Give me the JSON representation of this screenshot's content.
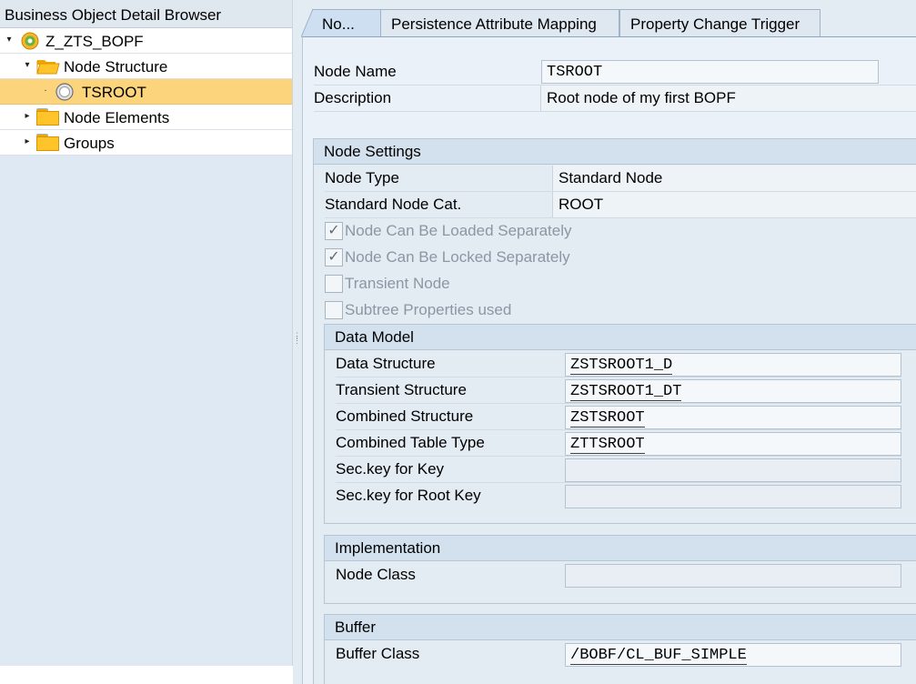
{
  "left_panel": {
    "title": "Business Object Detail Browser",
    "tree": [
      {
        "label": "Z_ZTS_BOPF",
        "icon": "business-object-icon",
        "expander": "▾"
      },
      {
        "label": "Node Structure",
        "icon": "open-folder-icon",
        "expander": "▾"
      },
      {
        "label": "TSROOT",
        "icon": "node-icon",
        "expander": "·",
        "selected": true
      },
      {
        "label": "Node Elements",
        "icon": "folder-icon",
        "expander": "▸"
      },
      {
        "label": "Groups",
        "icon": "folder-icon",
        "expander": "▸"
      }
    ]
  },
  "tabs": [
    {
      "label": "No...",
      "active": true
    },
    {
      "label": "Persistence Attribute Mapping",
      "active": false
    },
    {
      "label": "Property Change Trigger",
      "active": false
    }
  ],
  "node": {
    "name_label": "Node Name",
    "name_value": "TSROOT",
    "description_label": "Description",
    "description_value": "Root node of my first BOPF"
  },
  "node_settings": {
    "title": "Node Settings",
    "node_type_label": "Node Type",
    "node_type_value": "Standard Node",
    "category_label": "Standard Node Cat.",
    "category_value": "ROOT",
    "checkboxes": [
      {
        "label": "Node Can Be Loaded Separately",
        "checked": true,
        "mark": "✓"
      },
      {
        "label": "Node Can Be Locked Separately",
        "checked": true,
        "mark": "✓"
      },
      {
        "label": "Transient Node",
        "checked": false,
        "mark": ""
      },
      {
        "label": "Subtree Properties used",
        "checked": false,
        "mark": ""
      }
    ]
  },
  "data_model": {
    "title": "Data Model",
    "fields": [
      {
        "label": "Data Structure",
        "value": "ZSTSROOT1_D"
      },
      {
        "label": "Transient Structure",
        "value": "ZSTSROOT1_DT"
      },
      {
        "label": "Combined Structure",
        "value": "ZSTSROOT"
      },
      {
        "label": "Combined Table Type",
        "value": "ZTTSROOT"
      },
      {
        "label": "Sec.key for Key",
        "value": ""
      },
      {
        "label": "Sec.key for Root Key",
        "value": ""
      }
    ]
  },
  "implementation": {
    "title": "Implementation",
    "node_class_label": "Node Class",
    "node_class_value": ""
  },
  "buffer": {
    "title": "Buffer",
    "buffer_class_label": "Buffer Class",
    "buffer_class_value": "/BOBF/CL_BUF_SIMPLE"
  },
  "colors": {
    "selection": "#fcd47c",
    "panel_bg": "#dfe9f4",
    "content_bg": "#eaf1f8",
    "group_header": "#d3e1ee"
  }
}
